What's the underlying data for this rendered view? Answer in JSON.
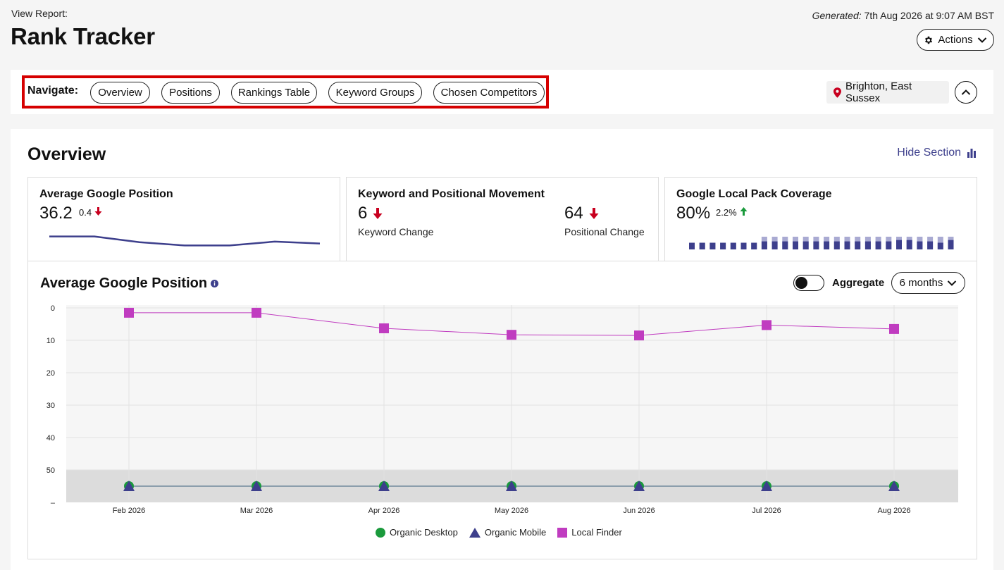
{
  "header": {
    "view_report": "View Report:",
    "title": "Rank Tracker",
    "generated_label": "Generated:",
    "generated_value": "7th Aug 2026 at 9:07 AM BST",
    "actions_label": "Actions"
  },
  "nav": {
    "label": "Navigate:",
    "items": [
      "Overview",
      "Positions",
      "Rankings Table",
      "Keyword Groups",
      "Chosen Competitors"
    ],
    "location": "Brighton, East Sussex"
  },
  "overview": {
    "title": "Overview",
    "hide_section": "Hide Section",
    "cards": {
      "avg_position": {
        "title": "Average Google Position",
        "value": "36.2",
        "change": "0.4",
        "direction": "down"
      },
      "movement": {
        "title": "Keyword and Positional Movement",
        "keyword_value": "6",
        "keyword_label": "Keyword Change",
        "positional_value": "64",
        "positional_label": "Positional Change"
      },
      "local_pack": {
        "title": "Google Local Pack Coverage",
        "value": "80%",
        "change": "2.2%",
        "direction": "up"
      }
    },
    "chart_panel": {
      "title": "Average Google Position",
      "aggregate_label": "Aggregate",
      "aggregate_on": false,
      "range_label": "6 months"
    }
  },
  "colors": {
    "brand": "#3d3f8c",
    "down": "#c8001f",
    "up": "#1a9a3c",
    "local_finder": "#c03cc0",
    "organic_desktop": "#1a9a3c",
    "organic_mobile": "#3d3f8c",
    "highlight": "#d60000"
  },
  "chart_data": {
    "type": "line",
    "categories": [
      "Feb 2026",
      "Mar 2026",
      "Apr 2026",
      "May 2026",
      "Jun 2026",
      "Jul 2026",
      "Aug 2026"
    ],
    "y_ticks": [
      "0",
      "10",
      "20",
      "30",
      "40",
      "50",
      "–"
    ],
    "ylim": [
      0,
      60
    ],
    "y_inverted": true,
    "series": [
      {
        "name": "Organic Desktop",
        "marker": "circle",
        "values": [
          55,
          55,
          55,
          55,
          55,
          55,
          55
        ]
      },
      {
        "name": "Organic Mobile",
        "marker": "triangle",
        "values": [
          55,
          55,
          55,
          55,
          55,
          55,
          55
        ]
      },
      {
        "name": "Local Finder",
        "marker": "square",
        "values": [
          1.5,
          1.5,
          6.3,
          8.3,
          8.5,
          5.3,
          6.5
        ]
      }
    ],
    "legend_position": "bottom",
    "grid": true,
    "shaded_band": [
      50,
      60
    ]
  },
  "sparkline": [
    36.0,
    36.0,
    36.9,
    37.4,
    37.4,
    36.8,
    37.1
  ],
  "coverage_bars": [
    {
      "total": 1.0,
      "filled": 1.0
    },
    {
      "total": 1.0,
      "filled": 1.0
    },
    {
      "total": 1.0,
      "filled": 1.0
    },
    {
      "total": 1.0,
      "filled": 1.0
    },
    {
      "total": 1.0,
      "filled": 1.0
    },
    {
      "total": 1.0,
      "filled": 1.0
    },
    {
      "total": 1.0,
      "filled": 1.0
    },
    {
      "total": 1.9,
      "filled": 1.2
    },
    {
      "total": 1.9,
      "filled": 1.2
    },
    {
      "total": 1.9,
      "filled": 1.2
    },
    {
      "total": 1.9,
      "filled": 1.2
    },
    {
      "total": 1.9,
      "filled": 1.2
    },
    {
      "total": 1.9,
      "filled": 1.2
    },
    {
      "total": 1.9,
      "filled": 1.2
    },
    {
      "total": 1.9,
      "filled": 1.2
    },
    {
      "total": 1.9,
      "filled": 1.2
    },
    {
      "total": 1.9,
      "filled": 1.2
    },
    {
      "total": 1.9,
      "filled": 1.2
    },
    {
      "total": 1.9,
      "filled": 1.2
    },
    {
      "total": 1.9,
      "filled": 1.2
    },
    {
      "total": 1.9,
      "filled": 1.4
    },
    {
      "total": 1.9,
      "filled": 1.4
    },
    {
      "total": 1.9,
      "filled": 1.2
    },
    {
      "total": 1.9,
      "filled": 1.2
    },
    {
      "total": 1.9,
      "filled": 1.0
    },
    {
      "total": 1.9,
      "filled": 1.4
    }
  ]
}
